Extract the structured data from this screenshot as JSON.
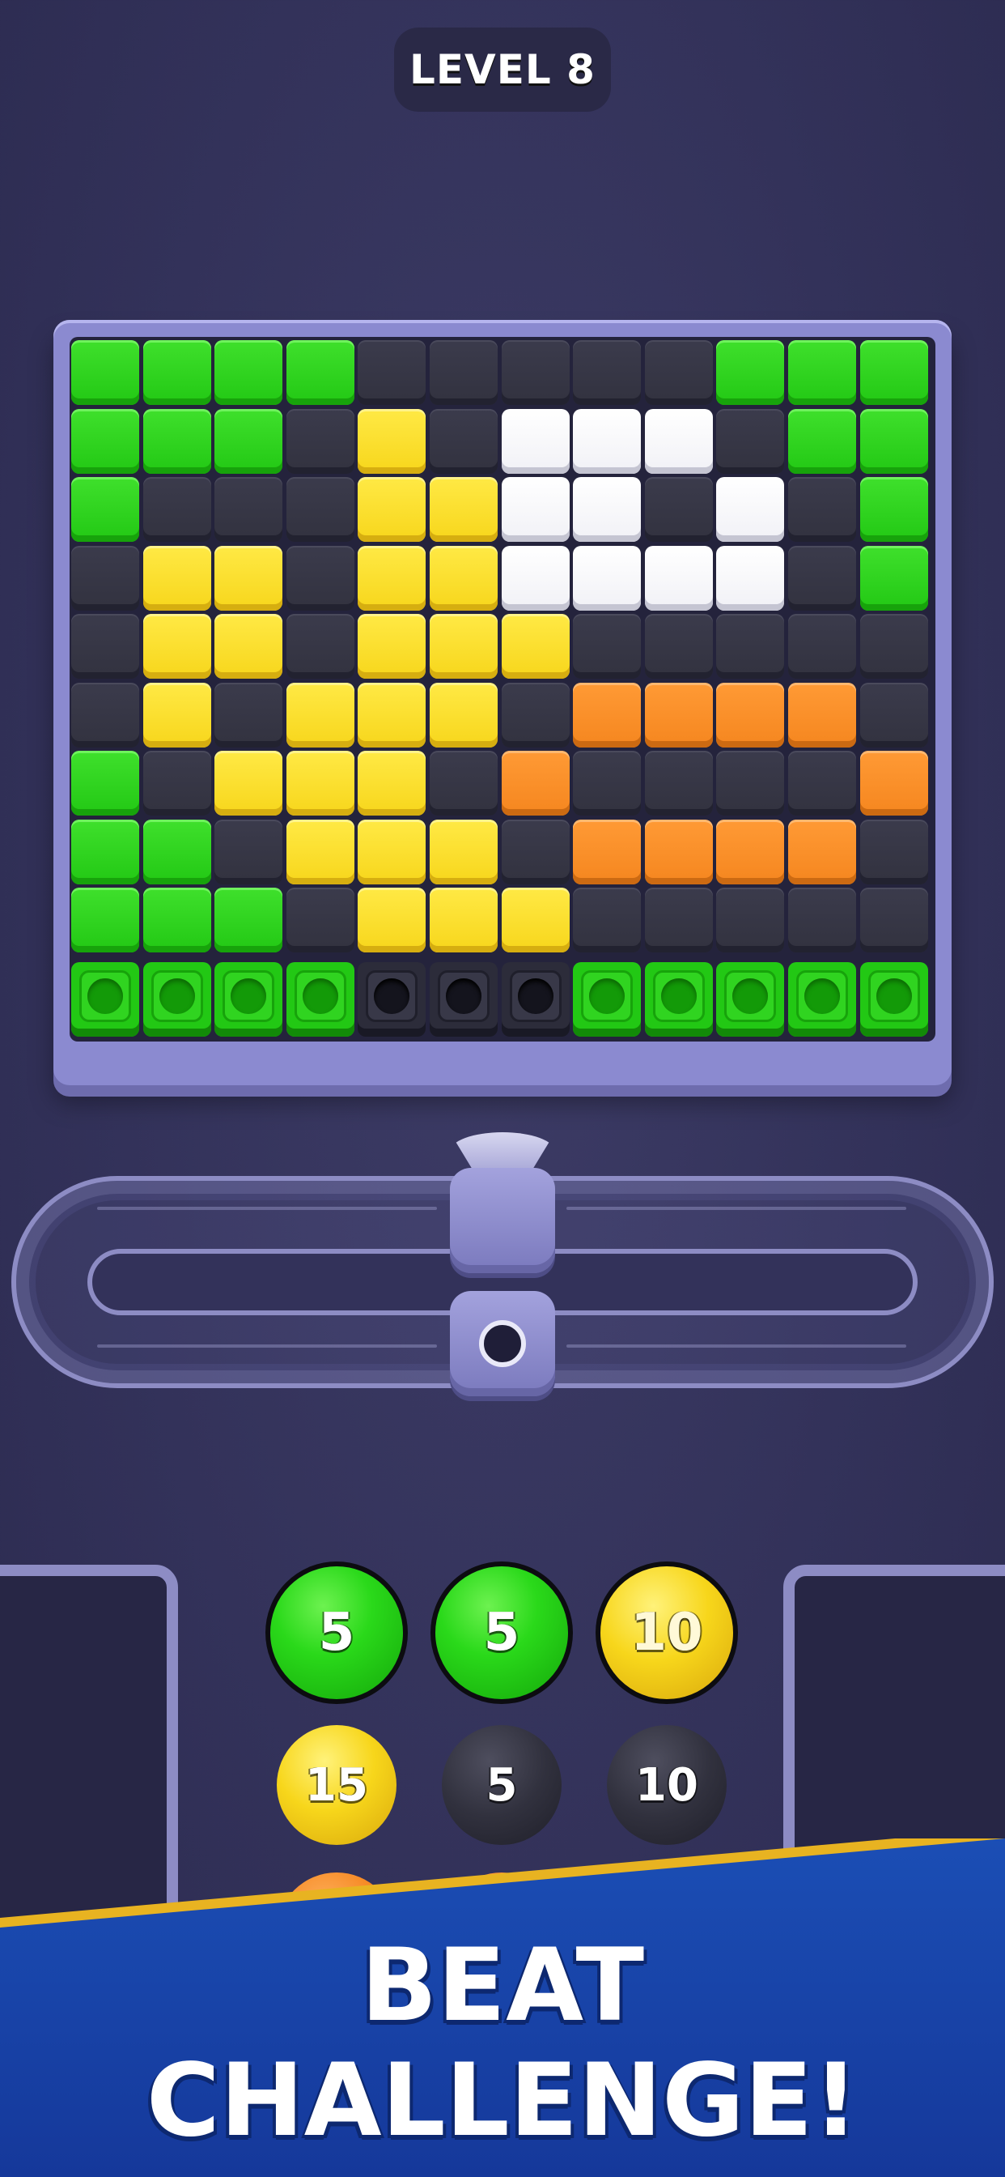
{
  "header": {
    "level_label": "LEVEL 8"
  },
  "colors": {
    "background": "#33325a",
    "board_frame": "#8b8ad0",
    "green": "#22c814",
    "yellow": "#f7d61b",
    "white": "#ffffff",
    "orange": "#f5861f",
    "dark": "#32323f",
    "banner": "#1b4eb5",
    "banner_stripe": "#e8b321"
  },
  "board": {
    "rows": [
      [
        "g",
        "g",
        "g",
        "g",
        "d",
        "d",
        "d",
        "d",
        "d",
        "g",
        "g",
        "g"
      ],
      [
        "g",
        "g",
        "g",
        "d",
        "y",
        "d",
        "w",
        "w",
        "w",
        "d",
        "g",
        "g"
      ],
      [
        "g",
        "d",
        "d",
        "d",
        "y",
        "y",
        "w",
        "w",
        "d",
        "w",
        "d",
        "g"
      ],
      [
        "d",
        "y",
        "y",
        "d",
        "y",
        "y",
        "w",
        "w",
        "w",
        "w",
        "d",
        "g"
      ],
      [
        "d",
        "y",
        "y",
        "d",
        "y",
        "y",
        "y",
        "d",
        "d",
        "d",
        "d",
        "d"
      ],
      [
        "d",
        "y",
        "d",
        "y",
        "y",
        "y",
        "d",
        "o",
        "o",
        "o",
        "o",
        "d"
      ],
      [
        "g",
        "d",
        "y",
        "y",
        "y",
        "d",
        "o",
        "d",
        "d",
        "d",
        "d",
        "o"
      ],
      [
        "g",
        "g",
        "d",
        "y",
        "y",
        "y",
        "d",
        "o",
        "o",
        "o",
        "o",
        "d"
      ],
      [
        "g",
        "g",
        "g",
        "d",
        "y",
        "y",
        "y",
        "d",
        "d",
        "d",
        "d",
        "d"
      ]
    ],
    "shooters": [
      "green",
      "green",
      "green",
      "green",
      "dark",
      "dark",
      "dark",
      "green",
      "green",
      "green",
      "green",
      "green"
    ]
  },
  "balls": [
    {
      "value": "5",
      "color": "green",
      "active": true
    },
    {
      "value": "5",
      "color": "green",
      "active": true
    },
    {
      "value": "10",
      "color": "yellow",
      "active": true
    },
    {
      "value": "15",
      "color": "yellow",
      "active": false
    },
    {
      "value": "5",
      "color": "dark",
      "active": false
    },
    {
      "value": "10",
      "color": "dark",
      "active": false
    },
    {
      "value": "",
      "color": "orange",
      "active": false
    },
    {
      "value": "",
      "color": "orange",
      "active": false
    }
  ],
  "banner": {
    "line1": "BEAT",
    "line2": "CHALLENGE!"
  }
}
